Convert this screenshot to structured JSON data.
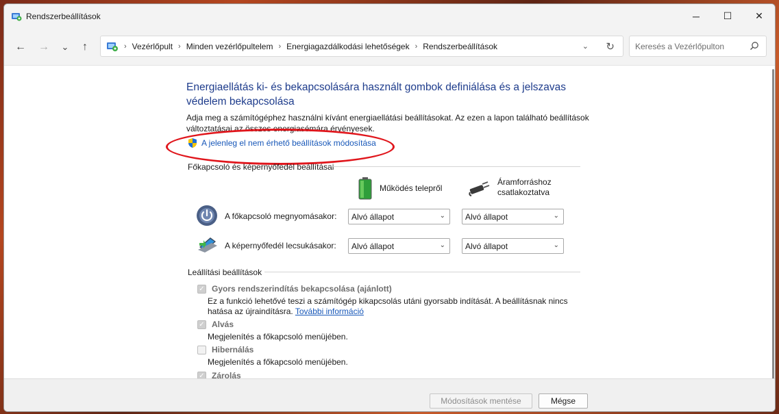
{
  "window": {
    "title": "Rendszerbeállítások",
    "icon": "control-panel-icon"
  },
  "titlebar_buttons": {
    "minimize": "─",
    "maximize": "☐",
    "close": "✕"
  },
  "nav": {
    "back": "←",
    "forward": "→",
    "recent": "⌄",
    "up": "↑",
    "breadcrumbs": [
      "Vezérlőpult",
      "Minden vezérlőpultelem",
      "Energiagazdálkodási lehetőségek",
      "Rendszerbeállítások"
    ],
    "refresh": "↻"
  },
  "search": {
    "placeholder": "Keresés a Vezérlőpulton",
    "value": ""
  },
  "page": {
    "heading": "Energiaellátás ki- és bekapcsolására használt gombok definiálása és a jelszavas védelem bekapcsolása",
    "description": "Adja meg a számítógéphez használni kívánt energiaellátási beállításokat. Az ezen a lapon található beállítások változtatásai az összes energiasémára érvényesek.",
    "uac_link": "A jelenleg el nem érhető beállítások módosítása"
  },
  "buttons_group": {
    "title": "Főkapcsoló és képernyőfedél beállításai",
    "col_battery": "Működés telepről",
    "col_plugged_line1": "Áramforráshoz",
    "col_plugged_line2": "csatlakoztatva",
    "rows": [
      {
        "label": "A főkapcsoló megnyomásakor:",
        "battery": "Alvó állapot",
        "plugged": "Alvó állapot"
      },
      {
        "label": "A képernyőfedél lecsukásakor:",
        "battery": "Alvó állapot",
        "plugged": "Alvó állapot"
      }
    ]
  },
  "shutdown_group": {
    "title": "Leállítási beállítások",
    "items": [
      {
        "label": "Gyors rendszerindítás bekapcsolása (ajánlott)",
        "checked": true,
        "desc": "Ez a funkció lehetővé teszi a számítógép kikapcsolás utáni gyorsabb indítását. A beállításnak nincs hatása az újraindításra.",
        "link": "További információ"
      },
      {
        "label": "Alvás",
        "checked": true,
        "desc": "Megjelenítés a főkapcsoló menüjében."
      },
      {
        "label": "Hibernálás",
        "checked": false,
        "desc": "Megjelenítés a főkapcsoló menüjében."
      },
      {
        "label": "Zárolás",
        "checked": true,
        "desc": ""
      }
    ]
  },
  "footer": {
    "save": "Módosítások mentése",
    "cancel": "Mégse"
  },
  "colors": {
    "heading": "#1e3c8c",
    "link": "#1757b8",
    "annotation": "#e0161c"
  }
}
